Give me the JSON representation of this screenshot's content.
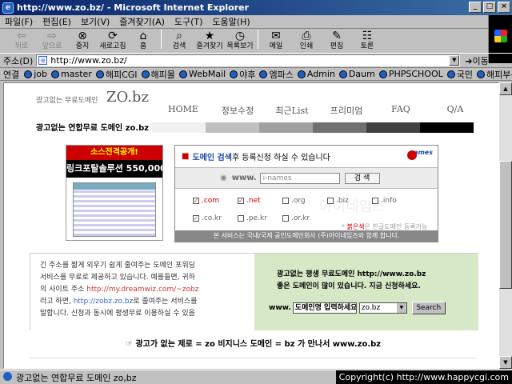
{
  "window": {
    "title": "http://www.zo.bz/ - Microsoft Internet Explorer",
    "controls": [
      "_",
      "□",
      "×"
    ]
  },
  "menu": [
    "파일(F)",
    "편집(E)",
    "보기(V)",
    "즐겨찾기(A)",
    "도구(T)",
    "도움말(H)"
  ],
  "toolbar": {
    "back": "뒤로",
    "forward": "앞으로",
    "stop": "중지",
    "refresh": "새로고침",
    "home": "홈",
    "search": "검색",
    "favorites": "즐겨찾기",
    "history": "목록보기",
    "mail": "메일",
    "print": "인쇄",
    "edit": "편집",
    "discuss": "토론"
  },
  "address": {
    "label": "주소(D)",
    "url": "http://www.zo.bz/",
    "go": "이동"
  },
  "links": {
    "label": "연결",
    "items": [
      "job",
      "master",
      "해피CGI",
      "해피몰",
      "WebMail",
      "야후",
      "엠파스",
      "Admin",
      "Daum",
      "PHPSCHOOL",
      "국민",
      "해피부동산"
    ]
  },
  "status": {
    "text": "광고없는 연합무료 도메인 zo,bz",
    "copyright": "Copyright(c) http://www.happycgi.com"
  },
  "page": {
    "subtitle": "광고없는 무료도메인",
    "logo": "ZO.bz",
    "nav": [
      "HOME",
      "정보수정",
      "최근List",
      "프리미엄",
      "FAQ",
      "Q/A"
    ],
    "tagline": "광고없는 연합무료 도메인 zo.bz",
    "stripe_colors": [
      "#f0f0f0",
      "#c0c0c0",
      "#a0a0a0",
      "#707070",
      "#404040",
      "#000000"
    ],
    "ad": {
      "line1": "소스전격공개!",
      "line2": "링크포탈솔루션 550,000"
    },
    "search_box": {
      "title_strong": "도메인 검색",
      "title_mid": " 후 ",
      "title_rest": "등록신청 하실 수 있습니다",
      "brand": "names",
      "www": "www.",
      "placeholder": "i-names",
      "button": "검  색",
      "watermark": "아이네임즈",
      "tlds": [
        {
          "label": ".com",
          "checked": true,
          "color": "red"
        },
        {
          "label": ".net",
          "checked": true,
          "color": "red"
        },
        {
          "label": ".org",
          "checked": false,
          "color": "gray"
        },
        {
          "label": ".biz",
          "checked": false,
          "color": "gray"
        },
        {
          "label": ".info",
          "checked": false,
          "color": "gray"
        },
        {
          "label": ".co.kr",
          "checked": true,
          "color": "gray"
        },
        {
          "label": ".pe.kr",
          "checked": false,
          "color": "gray"
        },
        {
          "label": ".or.kr",
          "checked": false,
          "color": "gray"
        }
      ],
      "red_note_strong": "붉은색",
      "red_note_rest": "은 한글도메인 등록가능",
      "footer": "본 서비스는 국내/국제 공인도메인회사 (주)아이네임즈와 함께 합니다."
    },
    "intro": {
      "line1": "긴 주소를 짧게 외우기 쉽게 줄여주는 도메인 포워딩",
      "line2": "서비스를 무료로 제공하고 있습니다. 예를들면, 귀하",
      "line3_pre": "의 사이트 주소 ",
      "line3_link": "http://my.dreamwiz.com/~zobz",
      "line4_pre": "라고 하면, ",
      "line4_link": "http://zobz.zo.bz",
      "line4_post": "로 줄여주는 서비스를",
      "line5": "말합니다. 신청과 동시에 평생무료 이용하실 수 있음"
    },
    "signup": {
      "line1": "광고없는 평생 무료도메인 http://www.zo.bz",
      "line2": "좋은 도메인이 많이 있습니다. 지금 신청하세요.",
      "www": "www.",
      "input_value": "도메인명 입력하세요.",
      "select_value": "zo.bz",
      "button": "Search"
    },
    "bottom_line": "☞ 광고가 없는 제로 = zo   비지니스 도메인 = bz   가 만나서 www.zo.bz"
  }
}
